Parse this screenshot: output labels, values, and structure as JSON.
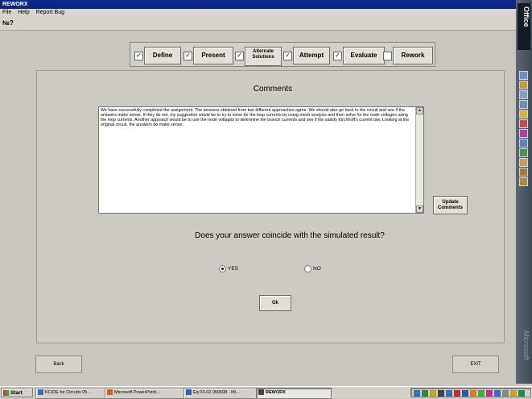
{
  "window": {
    "title": "REWORX"
  },
  "menu": [
    "File",
    "Help",
    "Report Bug"
  ],
  "toolbar": {
    "help_icon": "№?"
  },
  "stages": [
    {
      "label": "Define",
      "checked": true
    },
    {
      "label": "Present",
      "checked": true
    },
    {
      "label": "Alternate Solutions",
      "checked": true
    },
    {
      "label": "Attempt",
      "checked": true
    },
    {
      "label": "Evaluate",
      "checked": true
    },
    {
      "label": "Rework",
      "checked": false
    }
  ],
  "comments": {
    "title": "Comments",
    "text": "We have successfully completed the assignment.  The answers obtained from two different approaches agree.  We should also go back to the circuit and see if the answers make sense.  If they do not, my suggestion would be to try to solve for the loop currents by using mesh analysis and then solve for the node voltages using the loop currents.  Another approach would be to use the node voltages to determine the branch currents and see if the satisfy Kirchhoff's current law.  Looking at the original circuit, the answers do make sense.",
    "update_label": "Update Comments"
  },
  "question": {
    "text": "Does your answer coincide with the simulated result?",
    "yes_label": "YES",
    "no_label": "NO",
    "selected": "YES"
  },
  "ok_label": "Ok",
  "back_label": "Back",
  "exit_label": "EXIT",
  "office_bar": {
    "label": "Office",
    "vendor": "Microsoft"
  },
  "taskbar": {
    "start_label": "Start",
    "tasks": [
      {
        "label": "KCIDE for Circuits 05...",
        "icon_color": "#3a6fc0"
      },
      {
        "label": "Microsoft PowerPoint...",
        "icon_color": "#d0602a"
      },
      {
        "label": "Eq 03-02 050608 - Mi...",
        "icon_color": "#2f5fb0"
      },
      {
        "label": "REWORX",
        "icon_color": "#444444"
      }
    ]
  },
  "colors": {
    "titlebar": "#0b2a8a",
    "background": "#c9c6bd",
    "office_bar": "#4b5661"
  }
}
